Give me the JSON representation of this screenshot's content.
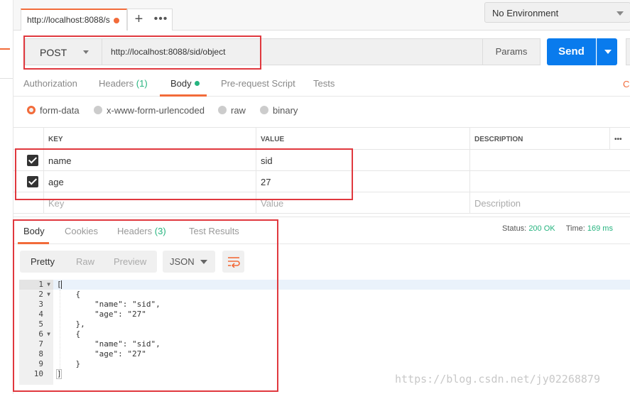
{
  "tabbar": {
    "request_tab_label": "http://localhost:8088/s",
    "new_tab_symbol": "+",
    "more_symbol": "•••"
  },
  "environment": {
    "selected": "No Environment"
  },
  "request": {
    "method": "POST",
    "url": "http://localhost:8088/sid/object",
    "params_label": "Params",
    "send_label": "Send"
  },
  "request_tabs": {
    "authorization": "Authorization",
    "headers_label": "Headers",
    "headers_count": "(1)",
    "body": "Body",
    "prerequest": "Pre-request Script",
    "tests": "Tests",
    "cookies_stub": "C"
  },
  "body_types": [
    {
      "label": "form-data",
      "selected": true
    },
    {
      "label": "x-www-form-urlencoded",
      "selected": false
    },
    {
      "label": "raw",
      "selected": false
    },
    {
      "label": "binary",
      "selected": false
    }
  ],
  "form_table": {
    "headers": {
      "key": "KEY",
      "value": "VALUE",
      "description": "DESCRIPTION",
      "more": "•••"
    },
    "rows": [
      {
        "checked": true,
        "key": "name",
        "value": "sid",
        "description": ""
      },
      {
        "checked": true,
        "key": "age",
        "value": "27",
        "description": ""
      }
    ],
    "placeholders": {
      "key": "Key",
      "value": "Value",
      "description": "Description"
    }
  },
  "response_tabs": {
    "body": "Body",
    "cookies": "Cookies",
    "headers_label": "Headers",
    "headers_count": "(3)",
    "test_results": "Test Results"
  },
  "response_status": {
    "status_label": "Status:",
    "status_value": "200 OK",
    "time_label": "Time:",
    "time_value": "169 ms"
  },
  "response_toolbar": {
    "pretty": "Pretty",
    "raw": "Raw",
    "preview": "Preview",
    "language": "JSON"
  },
  "response_body": {
    "line_numbers": [
      "1",
      "2",
      "3",
      "4",
      "5",
      "6",
      "7",
      "8",
      "9",
      "10"
    ],
    "lines": [
      "[",
      "    {",
      "        \"name\": \"sid\",",
      "        \"age\": \"27\"",
      "    },",
      "    {",
      "        \"name\": \"sid\",",
      "        \"age\": \"27\"",
      "    }",
      "]"
    ]
  },
  "watermark": "https://blog.csdn.net/jy02268879",
  "colors": {
    "accent_orange": "#f26b3a",
    "send_blue": "#097bed",
    "success_green": "#26b47f",
    "highlight_red": "#e0383e"
  }
}
